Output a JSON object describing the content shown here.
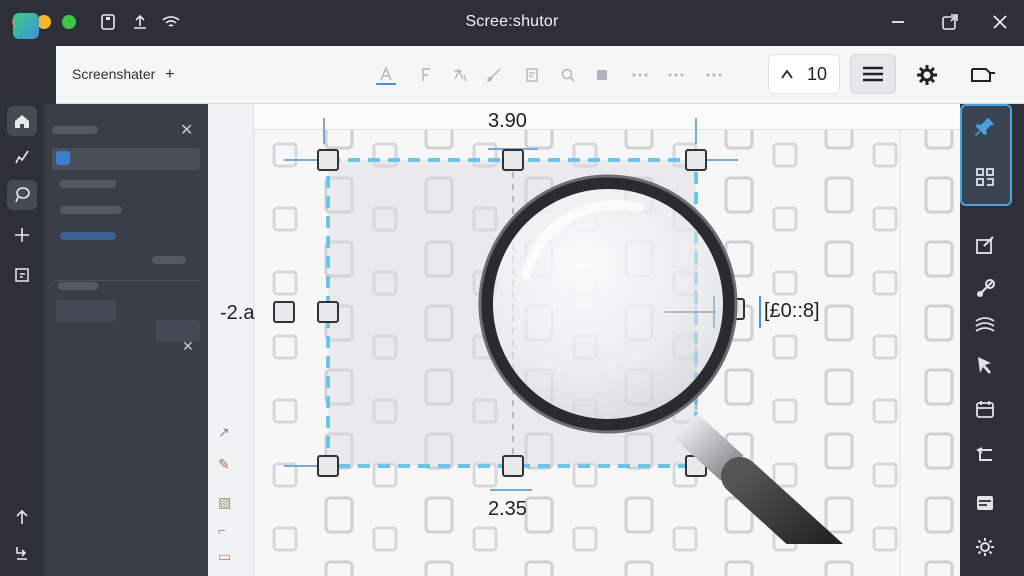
{
  "window": {
    "title": "Scree:shutor"
  },
  "toolbar": {
    "app_label": "Screenshater",
    "zoom_value": "10"
  },
  "measurements": {
    "top_width": "3.90",
    "bottom_width": "2.35",
    "left_offset": "-2.a",
    "right_value": "[£0::8]"
  },
  "rail": {
    "items": [
      "home-icon",
      "pen-icon",
      "lasso-icon",
      "move-icon",
      "export-icon",
      "arrow-up-icon",
      "share-icon"
    ]
  },
  "right_rail": {
    "items": [
      "pin-icon",
      "qr-icon",
      "edit-icon",
      "link-icon",
      "wave-icon",
      "pointer-icon",
      "calendar-icon",
      "undo-icon",
      "card-icon",
      "gear-icon"
    ]
  },
  "colors": {
    "accent": "#4a90d9",
    "selection": "#6ec3e8",
    "titlebar": "#2d3038"
  }
}
